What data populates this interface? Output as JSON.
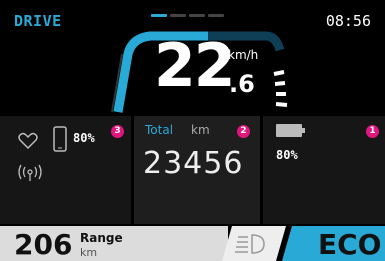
{
  "header": {
    "mode": "DRIVE",
    "time": "08:56"
  },
  "speed": {
    "integer": "22",
    "decimal": ".6",
    "unit": "km/h"
  },
  "panels": {
    "left": {
      "badge": "3",
      "phone_battery": "80%",
      "icons": [
        "heart-icon",
        "phone-icon",
        "signal-icon"
      ]
    },
    "middle": {
      "badge": "2",
      "label": "Total",
      "unit": "km",
      "value": "23456"
    },
    "right": {
      "badge": "1",
      "battery": "80%",
      "battery_level": 0.8
    }
  },
  "bottom": {
    "range_value": "206",
    "range_label": "Range",
    "range_unit": "km",
    "assist_mode": "ECO",
    "light_icon": "headlight-icon"
  },
  "colors": {
    "accent": "#29a9d6",
    "badge": "#e0157e"
  }
}
